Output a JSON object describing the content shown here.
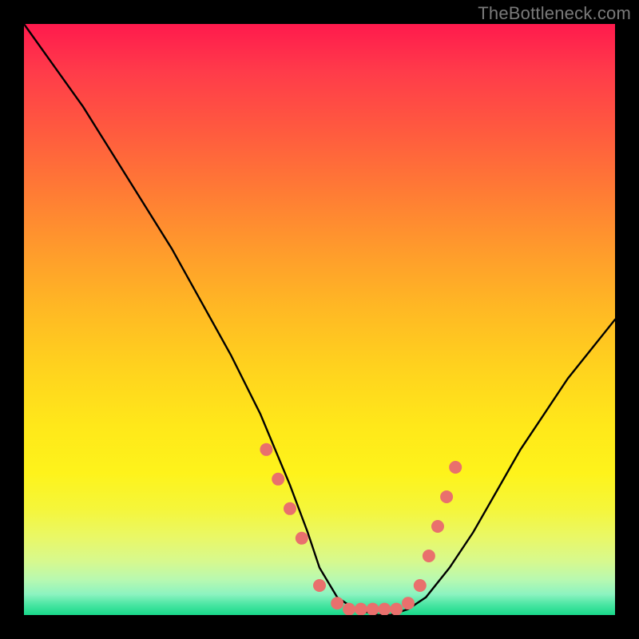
{
  "watermark": "TheBottleneck.com",
  "chart_data": {
    "type": "line",
    "title": "",
    "xlabel": "",
    "ylabel": "",
    "xlim": [
      0,
      100
    ],
    "ylim": [
      0,
      100
    ],
    "grid": false,
    "legend": false,
    "series": [
      {
        "name": "curve",
        "x": [
          0,
          5,
          10,
          15,
          20,
          25,
          30,
          35,
          40,
          45,
          48,
          50,
          53,
          56,
          60,
          62,
          65,
          68,
          72,
          76,
          80,
          84,
          88,
          92,
          96,
          100
        ],
        "y": [
          100,
          93,
          86,
          78,
          70,
          62,
          53,
          44,
          34,
          22,
          14,
          8,
          3,
          1,
          0,
          0,
          1,
          3,
          8,
          14,
          21,
          28,
          34,
          40,
          45,
          50
        ]
      }
    ],
    "markers": {
      "name": "dots",
      "x": [
        41,
        43,
        45,
        47,
        50,
        53,
        55,
        57,
        59,
        61,
        63,
        65,
        67,
        68.5,
        70,
        71.5,
        73
      ],
      "y": [
        28,
        23,
        18,
        13,
        5,
        2,
        1,
        1,
        1,
        1,
        1,
        2,
        5,
        10,
        15,
        20,
        25
      ]
    },
    "background_gradient": {
      "top": "#ff1a4d",
      "mid": "#ffe81a",
      "bottom": "#18d98a"
    }
  }
}
